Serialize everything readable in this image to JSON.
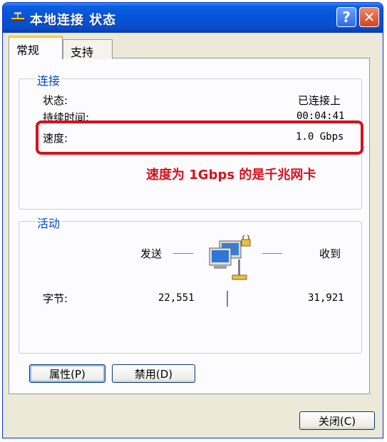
{
  "window": {
    "title": "本地连接 状态",
    "help_label": "?",
    "close_label": "✕"
  },
  "tabs": [
    {
      "label": "常规"
    },
    {
      "label": "支持"
    }
  ],
  "connection": {
    "group_title": "连接",
    "status_label": "状态:",
    "status_value": "已连接上",
    "duration_label": "持续时间:",
    "duration_value": "00:04:41",
    "speed_label": "速度:",
    "speed_value": "1.0 Gbps"
  },
  "annotation": "速度为 1Gbps 的是千兆网卡",
  "activity": {
    "group_title": "活动",
    "sent_label": "发送",
    "received_label": "收到",
    "bytes_label": "字节:",
    "sent_bytes": "22,551",
    "received_bytes": "31,921"
  },
  "buttons": {
    "properties": "属性(P)",
    "disable": "禁用(D)",
    "close": "关闭(C)"
  },
  "colors": {
    "title_bar": "#0553d9",
    "highlight": "#d6101c",
    "group_title": "#0046d5"
  },
  "icons": {
    "title": "network-connection-icon",
    "activity": "network-computers-icon"
  }
}
